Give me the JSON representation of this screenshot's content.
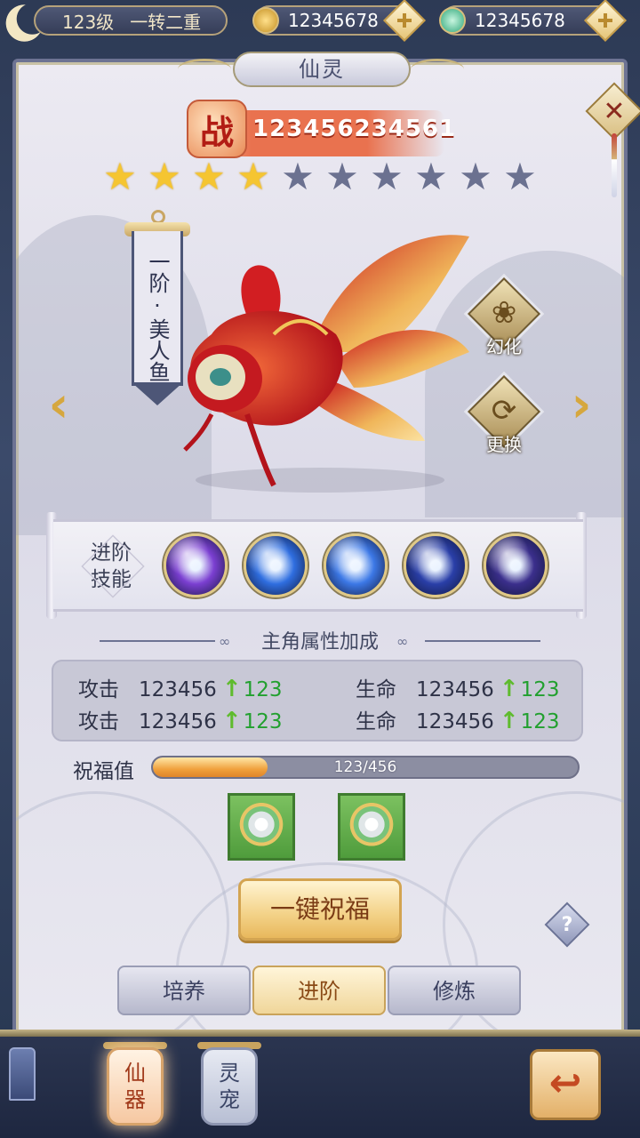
{
  "topbar": {
    "level": "123级",
    "rank": "一转二重",
    "gold_amount": "12345678",
    "jade_amount": "12345678",
    "gold_icon": "gold-coin-icon",
    "jade_icon": "jade-coin-icon"
  },
  "panel": {
    "title": "仙灵",
    "close_icon": "close-icon"
  },
  "power": {
    "icon_char": "战",
    "value": "123456234561"
  },
  "stars": {
    "lit": 4,
    "total": 10
  },
  "creature": {
    "stage_name": "一阶·美人鱼",
    "transform_label": "幻化",
    "replace_label": "更换"
  },
  "skills": {
    "label_line1": "进阶",
    "label_line2": "技能",
    "items": [
      {
        "icon": "butterfly-skill-icon",
        "color": "#7b3fd1"
      },
      {
        "icon": "shuriken-skill-icon",
        "color": "#2f6ee0"
      },
      {
        "icon": "comet-skill-icon",
        "color": "#3c78e6"
      },
      {
        "icon": "crystal-skill-icon",
        "color": "#2a3fa8"
      },
      {
        "icon": "slash-skill-icon",
        "color": "#3b2f8c"
      }
    ]
  },
  "attributes": {
    "title": "主角属性加成",
    "rows": [
      {
        "left_name": "攻击",
        "left_value": "123456",
        "left_inc": "123",
        "right_name": "生命",
        "right_value": "123456",
        "right_inc": "123"
      },
      {
        "left_name": "攻击",
        "left_value": "123456",
        "left_inc": "123",
        "right_name": "生命",
        "right_value": "123456",
        "right_inc": "123"
      }
    ]
  },
  "blessing": {
    "label": "祝福值",
    "progress_text": "123/456",
    "progress": 0.27
  },
  "items": [
    {
      "icon": "armor-item-icon"
    },
    {
      "icon": "armor-item-icon"
    }
  ],
  "actions": {
    "bless_all": "一键祝福",
    "help_icon": "help-icon"
  },
  "tabs": [
    {
      "label": "培养",
      "active": false
    },
    {
      "label": "进阶",
      "active": true
    },
    {
      "label": "修炼",
      "active": false
    }
  ],
  "bottom_nav": {
    "items": [
      {
        "label_top": "仙",
        "label_bottom": "器",
        "active": true
      },
      {
        "label_top": "灵",
        "label_bottom": "宠",
        "active": false
      }
    ],
    "back_icon": "return-icon"
  }
}
